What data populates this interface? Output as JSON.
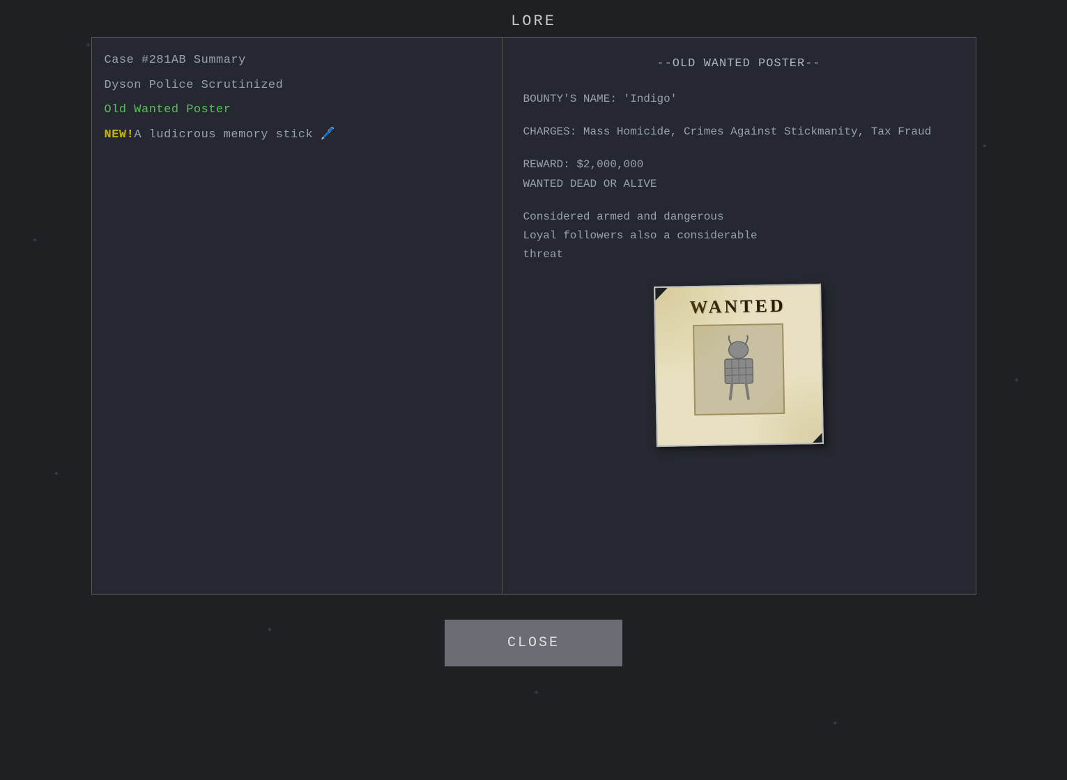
{
  "page": {
    "title": "LORE",
    "background_color": "#1e2124"
  },
  "left_panel": {
    "items": [
      {
        "id": "case-summary",
        "text": "Case #281AB Summary",
        "style": "normal",
        "new": false
      },
      {
        "id": "dyson-police",
        "text": "Dyson Police Scrutinized",
        "style": "normal",
        "new": false
      },
      {
        "id": "old-wanted",
        "text": "Old Wanted Poster",
        "style": "green",
        "new": false
      },
      {
        "id": "memory-stick",
        "new_label": "NEW!",
        "text": "A ludicrous memory stick 🖊️",
        "style": "new",
        "new": true
      }
    ]
  },
  "right_panel": {
    "poster_title": "--OLD WANTED POSTER--",
    "bounty_label": "BOUNTY'S NAME:",
    "bounty_name": "'Indigo'",
    "charges_label": "CHARGES:",
    "charges": "Mass Homicide, Crimes Against Stickmanity, Tax Fraud",
    "reward_label": "REWARD:",
    "reward_amount": "$2,000,000",
    "reward_status": "WANTED DEAD OR ALIVE",
    "description_line1": "Considered armed and dangerous",
    "description_line2": "Loyal followers also a considerable",
    "description_line3": "threat",
    "wanted_poster_text": "WANTED"
  },
  "close_button": {
    "label": "CLOSE"
  }
}
